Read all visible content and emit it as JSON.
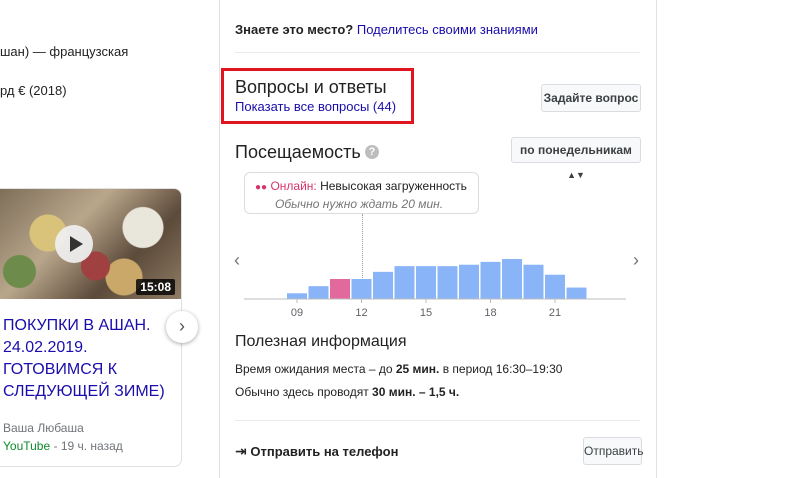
{
  "left": {
    "line1": "шан) — французская",
    "line2": "рд € (2018)"
  },
  "video": {
    "duration": "15:08",
    "title": "ПОКУПКИ В АШАН. 24.02.2019. ГОТОВИМСЯ К СЛЕДУЮЩЕЙ ЗИМЕ)",
    "author": "Ваша Любаша",
    "source": "YouTube",
    "age": " - 19 ч. назад"
  },
  "panel": {
    "know_question": "Знаете это место?",
    "know_link": "Поделитесь своими знаниями",
    "qa_title": "Вопросы и ответы",
    "qa_link": "Показать все вопросы (44)",
    "ask_button": "Задайте вопрос",
    "popular_title": "Посещаемость",
    "day_select": "по понедельникам",
    "live_label": "Онлайн:",
    "live_text": "Невысокая загруженность",
    "typical_text": "Обычно нужно ждать 20 мин.",
    "info_title": "Полезная информация",
    "wait_prefix": "Время ожидания места – до ",
    "wait_value": "25 мин.",
    "wait_suffix": " в период 16:30–19:30",
    "spend_prefix": "Обычно здесь проводят ",
    "spend_value": "30 мин. – 1,5 ч.",
    "send_label": "Отправить на телефон",
    "send_button": "Отправить"
  },
  "chart_data": {
    "type": "bar",
    "categories": [
      "07",
      "08",
      "09",
      "10",
      "11",
      "12",
      "13",
      "14",
      "15",
      "16",
      "17",
      "18",
      "19",
      "20",
      "21",
      "22",
      "23"
    ],
    "values": [
      0,
      0,
      4,
      9,
      14,
      14,
      19,
      23,
      23,
      23,
      24,
      26,
      28,
      24,
      17,
      8,
      0
    ],
    "highlight_index": 4,
    "tick_labels": [
      "09",
      "12",
      "15",
      "18",
      "21"
    ],
    "tick_positions": [
      "09",
      "12",
      "15",
      "18",
      "21"
    ],
    "bar_color": "#8ab4f8",
    "highlight_color": "#e2699b",
    "title": "",
    "xlabel": "",
    "ylabel": ""
  },
  "colors": {
    "link": "#1a0dab",
    "highlight_box": "#e1151f",
    "live": "#d6336c"
  }
}
